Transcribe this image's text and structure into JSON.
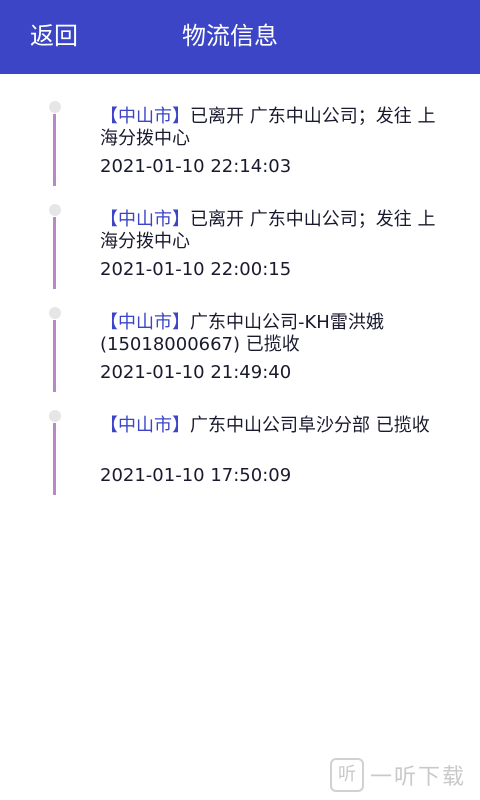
{
  "header": {
    "back_label": "返回",
    "title": "物流信息"
  },
  "entries": [
    {
      "city": "【中山市】",
      "message": "已离开 广东中山公司；发往 上海分拨中心",
      "time": "2021-01-10 22:14:03"
    },
    {
      "city": "【中山市】",
      "message": "已离开 广东中山公司；发往 上海分拨中心",
      "time": "2021-01-10 22:00:15"
    },
    {
      "city": "【中山市】",
      "message": "广东中山公司-KH雷洪娥(15018000667) 已揽收",
      "time": "2021-01-10 21:49:40"
    },
    {
      "city": "【中山市】",
      "message": "广东中山公司阜沙分部 已揽收",
      "time": "2021-01-10 17:50:09"
    }
  ],
  "watermark": {
    "logo": "听",
    "text": "一听下载"
  },
  "colors": {
    "header_bg": "#3b45c6",
    "timeline_line": "#b889c8",
    "city_text": "#3b45c6"
  }
}
